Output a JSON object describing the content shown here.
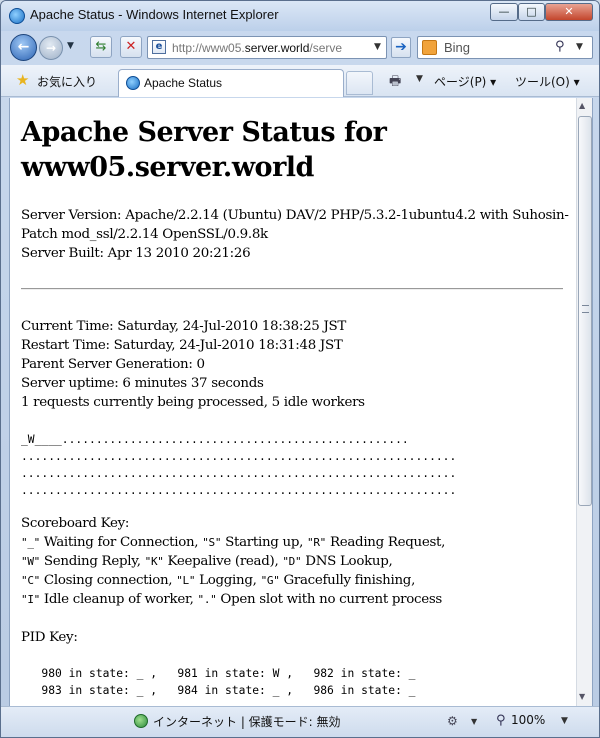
{
  "window": {
    "title": "Apache Status - Windows Internet Explorer",
    "close_label": "✕",
    "minimize_label": "—",
    "maximize_label": "□"
  },
  "nav": {
    "url_host": "http://www05.",
    "url_rest": "server.world",
    "url_tail": "/serve",
    "search_placeholder": "Bing"
  },
  "favorites": {
    "label": "お気に入り"
  },
  "tab": {
    "label": "Apache Status"
  },
  "commands": {
    "page": "ページ(P) ▾",
    "tools": "ツール(O) ▾"
  },
  "page": {
    "heading": "Apache Server Status for www05.server.world",
    "server_version_1": "Server Version: Apache/2.2.14 (Ubuntu) DAV/2 PHP/5.3.2-1ubuntu4.2 with Suhosin-",
    "server_version_2": "Patch mod_ssl/2.2.14 OpenSSL/0.9.8k",
    "server_built": "Server Built: Apr 13 2010 20:21:26",
    "current_time": "Current Time: Saturday, 24-Jul-2010 18:38:25 JST",
    "restart_time": "Restart Time: Saturday, 24-Jul-2010 18:31:48 JST",
    "parent_generation": "Parent Server Generation: 0",
    "uptime": "Server uptime: 6 minutes 37 seconds",
    "requests": "1 requests currently being processed, 5 idle workers",
    "scoreboard": [
      "_W____...................................................",
      "................................................................",
      "................................................................",
      "................................................................"
    ],
    "scoreboard_key_title": "Scoreboard Key:",
    "key_lines": [
      {
        "code1": "\"_\"",
        "text1": " Waiting for Connection, ",
        "code2": "\"S\"",
        "text2": " Starting up, ",
        "code3": "\"R\"",
        "text3": " Reading Request,"
      },
      {
        "code1": "\"W\"",
        "text1": " Sending Reply, ",
        "code2": "\"K\"",
        "text2": " Keepalive (read), ",
        "code3": "\"D\"",
        "text3": " DNS Lookup,"
      },
      {
        "code1": "\"C\"",
        "text1": " Closing connection, ",
        "code2": "\"L\"",
        "text2": " Logging, ",
        "code3": "\"G\"",
        "text3": " Gracefully finishing,"
      },
      {
        "code1": "\"I\"",
        "text1": " Idle cleanup of worker, ",
        "code2": "\".\"",
        "text2": " Open slot with no current process",
        "code3": "",
        "text3": ""
      }
    ],
    "pid_key_title": "PID Key:",
    "pid_lines": [
      "   980 in state: _ ,   981 in state: W ,   982 in state: _",
      "   983 in state: _ ,   984 in state: _ ,   986 in state: _"
    ]
  },
  "status": {
    "zone": "インターネット | 保護モード: 無効",
    "zoom": "100%"
  }
}
